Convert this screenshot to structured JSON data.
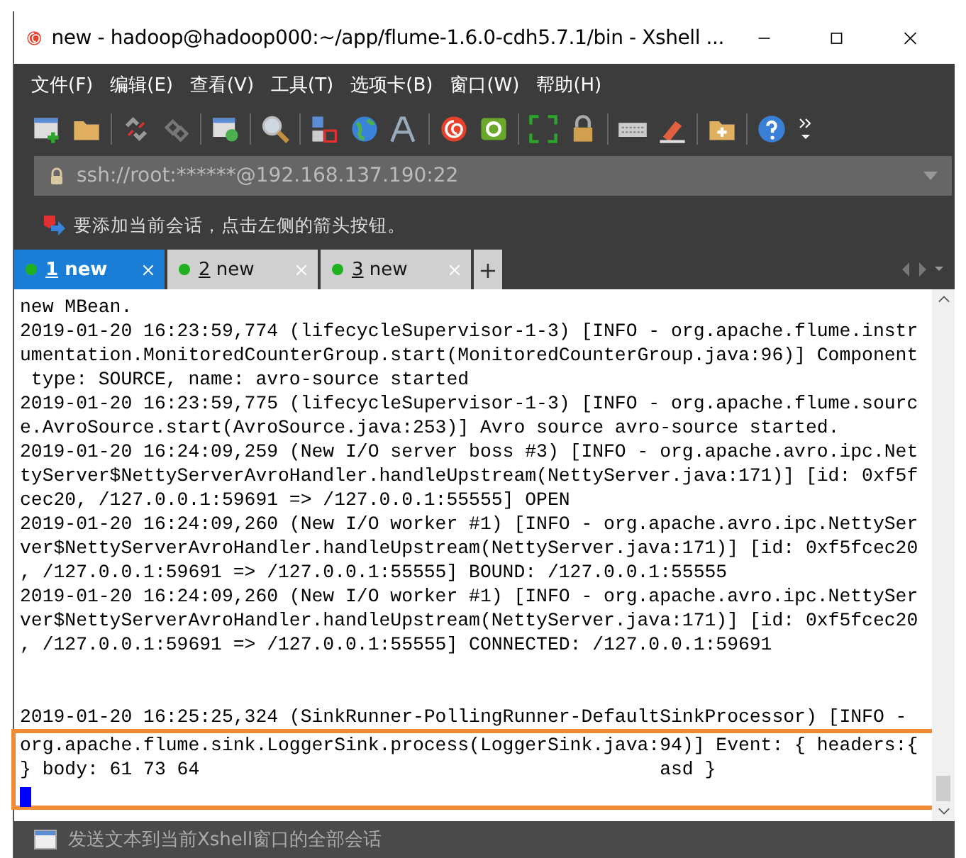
{
  "window": {
    "title": "new - hadoop@hadoop000:~/app/flume-1.6.0-cdh5.7.1/bin - Xshell ..."
  },
  "menu": [
    "文件(F)",
    "编辑(E)",
    "查看(V)",
    "工具(T)",
    "选项卡(B)",
    "窗口(W)",
    "帮助(H)"
  ],
  "address": {
    "value": "ssh://root:******@192.168.137.190:22"
  },
  "hint": "要添加当前会话，点击左侧的箭头按钮。",
  "tabs": [
    {
      "number": "1",
      "label": "new",
      "selected": true
    },
    {
      "number": "2",
      "label": "new",
      "selected": false
    },
    {
      "number": "3",
      "label": "new",
      "selected": false
    }
  ],
  "new_tab": "+",
  "terminal": {
    "lines": [
      {
        "kind": "line",
        "text": "new MBean."
      },
      {
        "kind": "line",
        "text": "2019-01-20 16:23:59,774 (lifecycleSupervisor-1-3) [INFO - org.apache.flume.instr"
      },
      {
        "kind": "line",
        "text": "umentation.MonitoredCounterGroup.start(MonitoredCounterGroup.java:96)] Component"
      },
      {
        "kind": "line",
        "text": " type: SOURCE, name: avro-source started"
      },
      {
        "kind": "line",
        "text": "2019-01-20 16:23:59,775 (lifecycleSupervisor-1-3) [INFO - org.apache.flume.sourc"
      },
      {
        "kind": "line",
        "text": "e.AvroSource.start(AvroSource.java:253)] Avro source avro-source started."
      },
      {
        "kind": "line",
        "text": "2019-01-20 16:24:09,259 (New I/O server boss #3) [INFO - org.apache.avro.ipc.Net"
      },
      {
        "kind": "line",
        "text": "tyServer$NettyServerAvroHandler.handleUpstream(NettyServer.java:171)] [id: 0xf5f"
      },
      {
        "kind": "line",
        "text": "cec20, /127.0.0.1:59691 => /127.0.0.1:55555] OPEN"
      },
      {
        "kind": "line",
        "text": "2019-01-20 16:24:09,260 (New I/O worker #1) [INFO - org.apache.avro.ipc.NettySer"
      },
      {
        "kind": "line",
        "text": "ver$NettyServerAvroHandler.handleUpstream(NettyServer.java:171)] [id: 0xf5fcec20"
      },
      {
        "kind": "line",
        "text": ", /127.0.0.1:59691 => /127.0.0.1:55555] BOUND: /127.0.0.1:55555"
      },
      {
        "kind": "line",
        "text": "2019-01-20 16:24:09,260 (New I/O worker #1) [INFO - org.apache.avro.ipc.NettySer"
      },
      {
        "kind": "line",
        "text": "ver$NettyServerAvroHandler.handleUpstream(NettyServer.java:171)] [id: 0xf5fcec20"
      },
      {
        "kind": "line",
        "text": ", /127.0.0.1:59691 => /127.0.0.1:55555] CONNECTED: /127.0.0.1:59691"
      },
      {
        "kind": "blank"
      },
      {
        "kind": "blank"
      },
      {
        "kind": "line",
        "text": "2019-01-20 16:25:25,324 (SinkRunner-PollingRunner-DefaultSinkProcessor) [INFO -"
      },
      {
        "kind": "highlight",
        "text": "org.apache.flume.sink.LoggerSink.process(LoggerSink.java:94)] Event: { headers:{"
      },
      {
        "kind": "highlight",
        "text": "} body: 61 73 64                                         asd }"
      },
      {
        "kind": "cursor"
      }
    ]
  },
  "status_bar": {
    "text": "发送文本到当前Xshell窗口的全部会话"
  }
}
